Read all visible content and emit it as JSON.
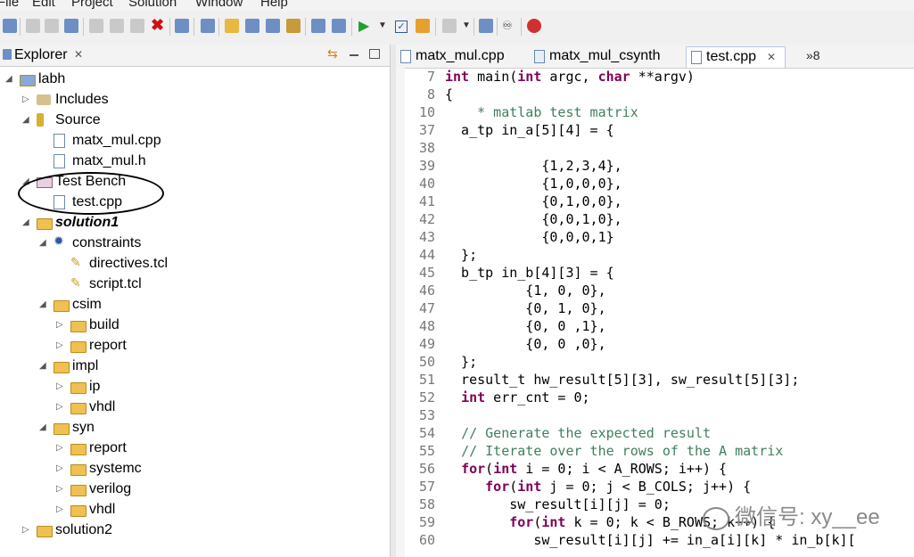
{
  "menu": [
    "File",
    "Edit",
    "Project",
    "Solution",
    "Window",
    "Help"
  ],
  "explorer": {
    "title": "Explorer",
    "tree": [
      {
        "label": "labh",
        "indent": 0,
        "twisty": "open",
        "icon": "project"
      },
      {
        "label": "Includes",
        "indent": 1,
        "twisty": "closed",
        "icon": "includes"
      },
      {
        "label": "Source",
        "indent": 1,
        "twisty": "open",
        "icon": "source"
      },
      {
        "label": "matx_mul.cpp",
        "indent": 2,
        "twisty": "",
        "icon": "cpp-file"
      },
      {
        "label": "matx_mul.h",
        "indent": 2,
        "twisty": "",
        "icon": "h-file"
      },
      {
        "label": "Test Bench",
        "indent": 1,
        "twisty": "open",
        "icon": "testbench"
      },
      {
        "label": "test.cpp",
        "indent": 2,
        "twisty": "",
        "icon": "cpp-file"
      },
      {
        "label": "solution1",
        "indent": 1,
        "twisty": "open",
        "icon": "folder",
        "bold": true
      },
      {
        "label": "constraints",
        "indent": 2,
        "twisty": "open",
        "icon": "gear"
      },
      {
        "label": "directives.tcl",
        "indent": 3,
        "twisty": "",
        "icon": "tcl-file"
      },
      {
        "label": "script.tcl",
        "indent": 3,
        "twisty": "",
        "icon": "tcl-file"
      },
      {
        "label": "csim",
        "indent": 2,
        "twisty": "open",
        "icon": "folder"
      },
      {
        "label": "build",
        "indent": 3,
        "twisty": "closed",
        "icon": "folder"
      },
      {
        "label": "report",
        "indent": 3,
        "twisty": "closed",
        "icon": "folder"
      },
      {
        "label": "impl",
        "indent": 2,
        "twisty": "open",
        "icon": "folder"
      },
      {
        "label": "ip",
        "indent": 3,
        "twisty": "closed",
        "icon": "folder"
      },
      {
        "label": "vhdl",
        "indent": 3,
        "twisty": "closed",
        "icon": "folder"
      },
      {
        "label": "syn",
        "indent": 2,
        "twisty": "open",
        "icon": "folder"
      },
      {
        "label": "report",
        "indent": 3,
        "twisty": "closed",
        "icon": "folder"
      },
      {
        "label": "systemc",
        "indent": 3,
        "twisty": "closed",
        "icon": "folder"
      },
      {
        "label": "verilog",
        "indent": 3,
        "twisty": "closed",
        "icon": "folder"
      },
      {
        "label": "vhdl",
        "indent": 3,
        "twisty": "closed",
        "icon": "folder"
      },
      {
        "label": "solution2",
        "indent": 1,
        "twisty": "closed",
        "icon": "folder"
      }
    ]
  },
  "editor": {
    "tabs": [
      {
        "label": "matx_mul.cpp",
        "active": false
      },
      {
        "label": "matx_mul_csynth",
        "active": false
      },
      {
        "label": "test.cpp",
        "active": true
      }
    ],
    "overflow": "»8",
    "lines": [
      {
        "n": "7",
        "code": "int main(int argc, char **argv)"
      },
      {
        "n": "8",
        "code": "{"
      },
      {
        "n": "10",
        "code": "    * matlab test matrix"
      },
      {
        "n": "37",
        "code": "  a_tp in_a[5][4] = {"
      },
      {
        "n": "38",
        "code": ""
      },
      {
        "n": "39",
        "code": "            {1,2,3,4},"
      },
      {
        "n": "40",
        "code": "            {1,0,0,0},"
      },
      {
        "n": "41",
        "code": "            {0,1,0,0},"
      },
      {
        "n": "42",
        "code": "            {0,0,1,0},"
      },
      {
        "n": "43",
        "code": "            {0,0,0,1}"
      },
      {
        "n": "44",
        "code": "  };"
      },
      {
        "n": "45",
        "code": "  b_tp in_b[4][3] = {"
      },
      {
        "n": "46",
        "code": "          {1, 0, 0},"
      },
      {
        "n": "47",
        "code": "          {0, 1, 0},"
      },
      {
        "n": "48",
        "code": "          {0, 0 ,1},"
      },
      {
        "n": "49",
        "code": "          {0, 0 ,0},"
      },
      {
        "n": "50",
        "code": "  };"
      },
      {
        "n": "51",
        "code": "  result_t hw_result[5][3], sw_result[5][3];"
      },
      {
        "n": "52",
        "code": "  int err_cnt = 0;"
      },
      {
        "n": "53",
        "code": ""
      },
      {
        "n": "54",
        "code": "  // Generate the expected result"
      },
      {
        "n": "55",
        "code": "  // Iterate over the rows of the A matrix"
      },
      {
        "n": "56",
        "code": "  for(int i = 0; i < A_ROWS; i++) {"
      },
      {
        "n": "57",
        "code": "     for(int j = 0; j < B_COLS; j++) {"
      },
      {
        "n": "58",
        "code": "        sw_result[i][j] = 0;"
      },
      {
        "n": "59",
        "code": "        for(int k = 0; k < B_ROWS; k++) {"
      },
      {
        "n": "60",
        "code": "           sw_result[i][j] += in_a[i][k] * in_b[k]["
      }
    ]
  },
  "watermark": "微信号: xy__ee",
  "colors": {
    "keyword": "#7f0055",
    "comment": "#3f7f5f",
    "linenum": "#787878"
  }
}
